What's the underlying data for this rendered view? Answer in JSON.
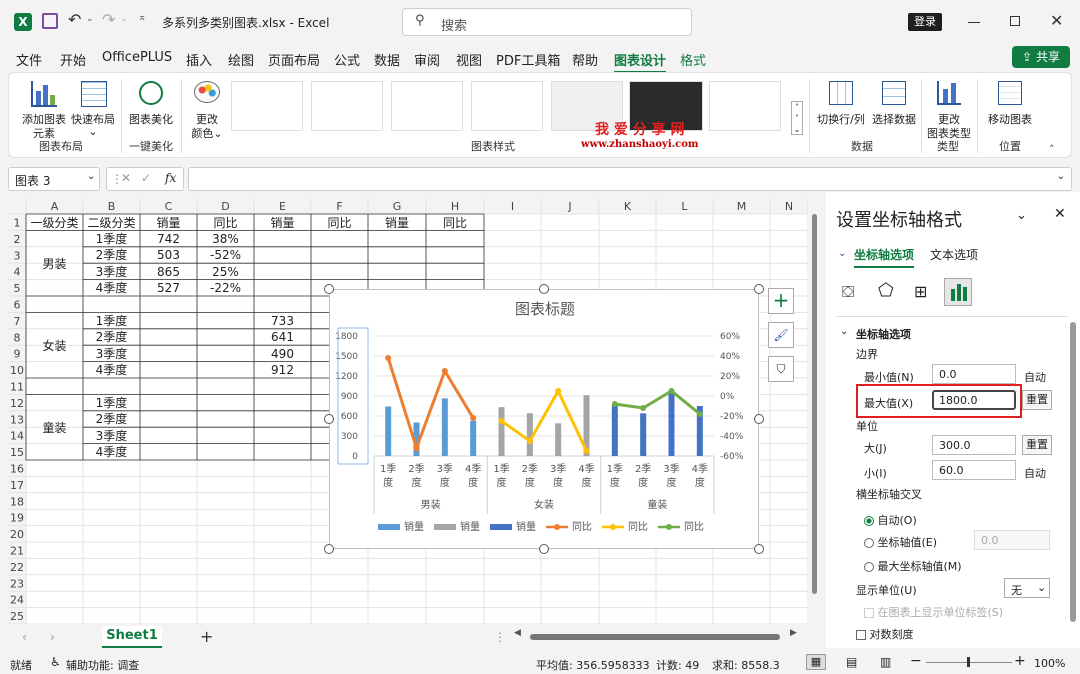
{
  "titlebar": {
    "filename": "多系列多类别图表.xlsx",
    "sep": "-",
    "app": "Excel",
    "search_placeholder": "搜索",
    "login": "登录",
    "share": "共享"
  },
  "menu": [
    "文件",
    "开始",
    "OfficePLUS",
    "插入",
    "绘图",
    "页面布局",
    "公式",
    "数据",
    "审阅",
    "视图",
    "PDF工具箱",
    "帮助",
    "图表设计",
    "格式"
  ],
  "ribbon": {
    "add_element": [
      "添加图表",
      "元素"
    ],
    "quick_layout": "快速布局",
    "beautify": "图表美化",
    "change_color": [
      "更改",
      "颜色"
    ],
    "switch_rowcol": "切换行/列",
    "select_data": "选择数据",
    "change_type": [
      "更改",
      "图表类型"
    ],
    "move_chart": "移动图表",
    "groups": [
      "图表布局",
      "一键美化",
      "图表样式",
      "数据",
      "类型",
      "位置"
    ],
    "watermark": "我 爱 分 享 网",
    "watermark_url": "www.zhanshaoyi.com"
  },
  "formula": {
    "namebox": "图表 3",
    "fx": "fx"
  },
  "sheet": {
    "columns": [
      "A",
      "B",
      "C",
      "D",
      "E",
      "F",
      "G",
      "H",
      "I",
      "J",
      "K",
      "L",
      "M",
      "N"
    ],
    "rows": [
      "1",
      "2",
      "3",
      "4",
      "5",
      "6",
      "7",
      "8",
      "9",
      "10",
      "11",
      "12",
      "13",
      "14",
      "15",
      "16",
      "17",
      "18",
      "19",
      "20",
      "21",
      "22",
      "23",
      "24",
      "25"
    ],
    "header": [
      "一级分类",
      "二级分类",
      "销量",
      "同比",
      "销量",
      "同比",
      "销量",
      "同比"
    ],
    "groups": [
      "男装",
      "女装",
      "童装"
    ],
    "quarters": [
      "1季度",
      "2季度",
      "3季度",
      "4季度"
    ],
    "men": {
      "sales": [
        "742",
        "503",
        "865",
        "527"
      ],
      "yoy": [
        "38%",
        "-52%",
        "25%",
        "-22%"
      ]
    },
    "women_sales": [
      "733",
      "641",
      "490",
      "912"
    ],
    "tab": "Sheet1"
  },
  "chart_data": {
    "type": "bar",
    "title": "图表标题",
    "categories": [
      "1季度",
      "2季度",
      "3季度",
      "4季度"
    ],
    "groups": [
      "男装",
      "女装",
      "童装"
    ],
    "ylim": [
      0,
      1800
    ],
    "yticks": [
      "0",
      "300",
      "600",
      "900",
      "1200",
      "1500",
      "1800"
    ],
    "y2lim": [
      -0.6,
      0.6
    ],
    "y2ticks": [
      "-60%",
      "-40%",
      "-20%",
      "0%",
      "20%",
      "40%",
      "60%"
    ],
    "series": [
      {
        "name": "销量",
        "type": "bar",
        "group": 0,
        "values": [
          742,
          503,
          865,
          527
        ],
        "color": "#5b9bd5"
      },
      {
        "name": "销量",
        "type": "bar",
        "group": 1,
        "values": [
          733,
          641,
          490,
          912
        ],
        "color": "#a5a5a5"
      },
      {
        "name": "销量",
        "type": "bar",
        "group": 2,
        "values": [
          760,
          640,
          980,
          750
        ],
        "color": "#4472c4"
      },
      {
        "name": "同比",
        "type": "line",
        "group": 0,
        "values": [
          0.38,
          -0.52,
          0.25,
          -0.22
        ],
        "color": "#ed7d31"
      },
      {
        "name": "同比",
        "type": "line",
        "group": 1,
        "values": [
          -0.25,
          -0.45,
          0.05,
          -0.55
        ],
        "color": "#ffc000"
      },
      {
        "name": "同比",
        "type": "line",
        "group": 2,
        "values": [
          -0.08,
          -0.12,
          0.05,
          -0.18
        ],
        "color": "#70ad47"
      }
    ],
    "legend": "bottom"
  },
  "pane": {
    "title": "设置坐标轴格式",
    "tab1": "坐标轴选项",
    "tab2": "文本选项",
    "section": "坐标轴选项",
    "bounds": "边界",
    "min_label": "最小值(N)",
    "min_value": "0.0",
    "auto": "自动",
    "max_label": "最大值(X)",
    "max_value": "1800.0",
    "reset": "重置",
    "units": "单位",
    "major_label": "大(J)",
    "major_value": "300.0",
    "minor_label": "小(I)",
    "minor_value": "60.0",
    "cross": "横坐标轴交叉",
    "opt_auto": "自动(O)",
    "opt_value": "坐标轴值(E)",
    "opt_value_field": "0.0",
    "opt_max": "最大坐标轴值(M)",
    "display_units": "显示单位(U)",
    "display_units_value": "无",
    "show_label": "在图表上显示单位标签(S)",
    "log": "对数刻度"
  },
  "status": {
    "ready": "就绪",
    "access": "辅助功能: 调查",
    "avg": "平均值: 356.5958333",
    "count": "计数: 49",
    "sum": "求和: 8558.3",
    "zoom": "100%"
  }
}
